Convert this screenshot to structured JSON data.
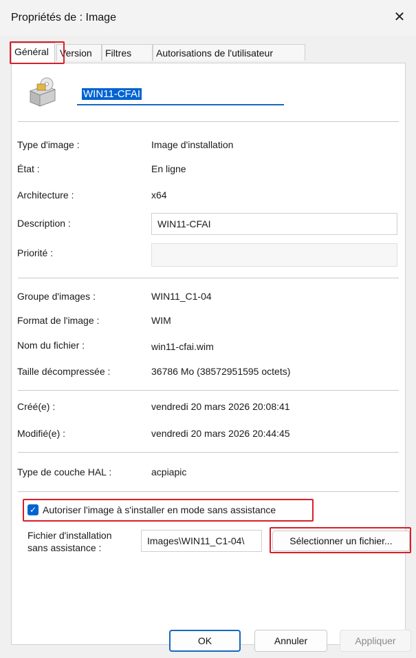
{
  "window": {
    "title": "Propriétés de : Image",
    "close_glyph": "✕"
  },
  "tabs": [
    {
      "label": "Général",
      "active": true
    },
    {
      "label": "Version"
    },
    {
      "label": "Filtres"
    },
    {
      "label": "Autorisations de l'utilisateur"
    }
  ],
  "image_name": "WIN11-CFAI",
  "icon": "installation-image-icon",
  "properties": {
    "type_label": "Type d'image :",
    "type_value": "Image d'installation",
    "state_label": "État :",
    "state_value": "En ligne",
    "arch_label": "Architecture :",
    "arch_value": "x64",
    "desc_label": "Description :",
    "desc_value": "WIN11-CFAI",
    "priority_label": "Priorité :",
    "priority_value": ""
  },
  "file_info": {
    "group_label": "Groupe d'images :",
    "group_value": "WIN11_C1-04",
    "format_label": "Format de l'image :",
    "format_value": "WIM",
    "filename_label": "Nom du fichier :",
    "filename_value": "win11-cfai.wim",
    "size_label": "Taille décompressée :",
    "size_value": "36786 Mo (38572951595 octets)"
  },
  "dates": {
    "created_label": "Créé(e) :",
    "created_value": "vendredi 20 mars 2026 20:08:41",
    "modified_label": "Modifié(e) :",
    "modified_value": "vendredi 20 mars 2026 20:44:45"
  },
  "hal": {
    "label": "Type de couche HAL :",
    "value": "acpiapic"
  },
  "unattend": {
    "checkbox_label": "Autoriser l'image à s'installer en mode sans assistance",
    "checked": true,
    "file_label_line1": "Fichier d'installation",
    "file_label_line2": "sans assistance :",
    "file_value": "Images\\WIN11_C1-04\\",
    "select_button": "Sélectionner un fichier..."
  },
  "buttons": {
    "ok": "OK",
    "cancel": "Annuler",
    "apply": "Appliquer"
  },
  "colors": {
    "highlight": "#d81e28",
    "accent": "#0063d1"
  }
}
